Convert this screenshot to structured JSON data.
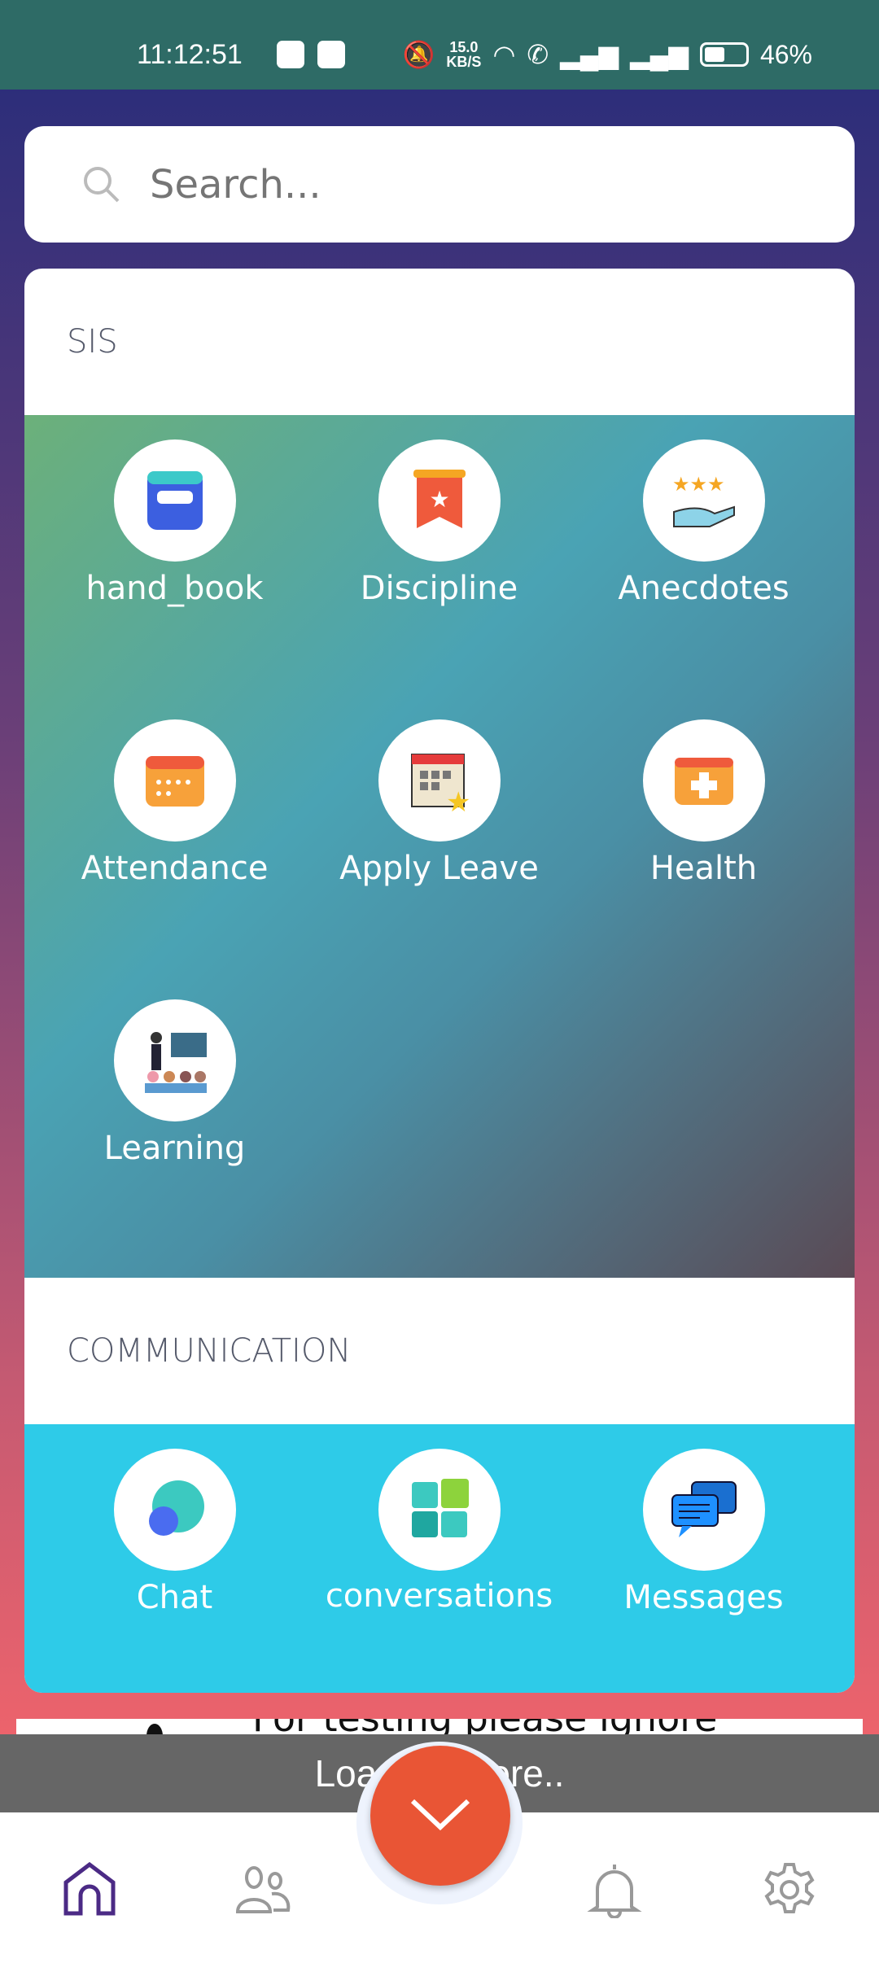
{
  "status_bar": {
    "time": "11:12:51",
    "net_speed": "15.0",
    "net_unit": "KB/S",
    "battery": "46%"
  },
  "search": {
    "placeholder": "Search..."
  },
  "sections": [
    {
      "title": "SIS",
      "items": [
        {
          "label": "hand_book",
          "icon": "handbook-icon"
        },
        {
          "label": "Discipline",
          "icon": "discipline-badge-icon"
        },
        {
          "label": "Anecdotes",
          "icon": "stars-hand-icon"
        },
        {
          "label": "Attendance",
          "icon": "calendar-icon"
        },
        {
          "label": "Apply Leave",
          "icon": "calendar-star-icon"
        },
        {
          "label": "Health",
          "icon": "first-aid-icon"
        },
        {
          "label": "Learning",
          "icon": "classroom-icon"
        }
      ]
    },
    {
      "title": "COMMUNICATION",
      "items": [
        {
          "label": "Chat",
          "icon": "chat-bubble-icon"
        },
        {
          "label": "conversations",
          "icon": "conversations-icon"
        },
        {
          "label": "Messages",
          "icon": "messages-icon"
        }
      ]
    }
  ],
  "background_item": "For testing please ignore",
  "toast": "Loading more..",
  "nav": {
    "items": [
      "home-icon",
      "people-icon",
      "bell-icon",
      "gear-icon"
    ],
    "active": "home-icon",
    "active_color": "#4b2a85",
    "fab_color": "#e95535"
  }
}
